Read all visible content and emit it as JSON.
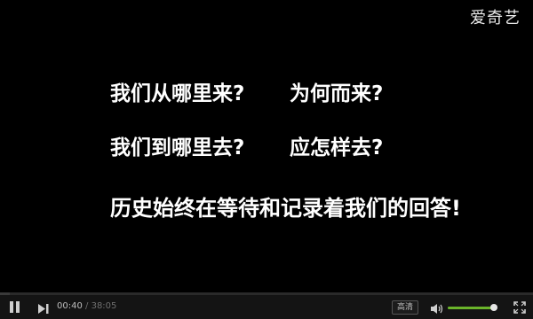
{
  "watermark": "爱奇艺",
  "subtitles": {
    "line1_left": "我们从哪里来?",
    "line1_right": "为何而来?",
    "line2_left": "我们到哪里去?",
    "line2_right": "应怎样去?",
    "line3": "历史始终在等待和记录着我们的回答!"
  },
  "player": {
    "current_time": "00:40",
    "separator": "/",
    "duration": "38:05",
    "quality_label": "高清",
    "progress_fraction": 0.0175,
    "volume_fraction": 0.93
  },
  "icons": {
    "play_pause": "pause-icon",
    "next": "next-icon",
    "volume": "speaker-icon",
    "fullscreen": "fullscreen-icon"
  },
  "colors": {
    "volume_fill": "#6ab42a",
    "background": "#000000"
  }
}
